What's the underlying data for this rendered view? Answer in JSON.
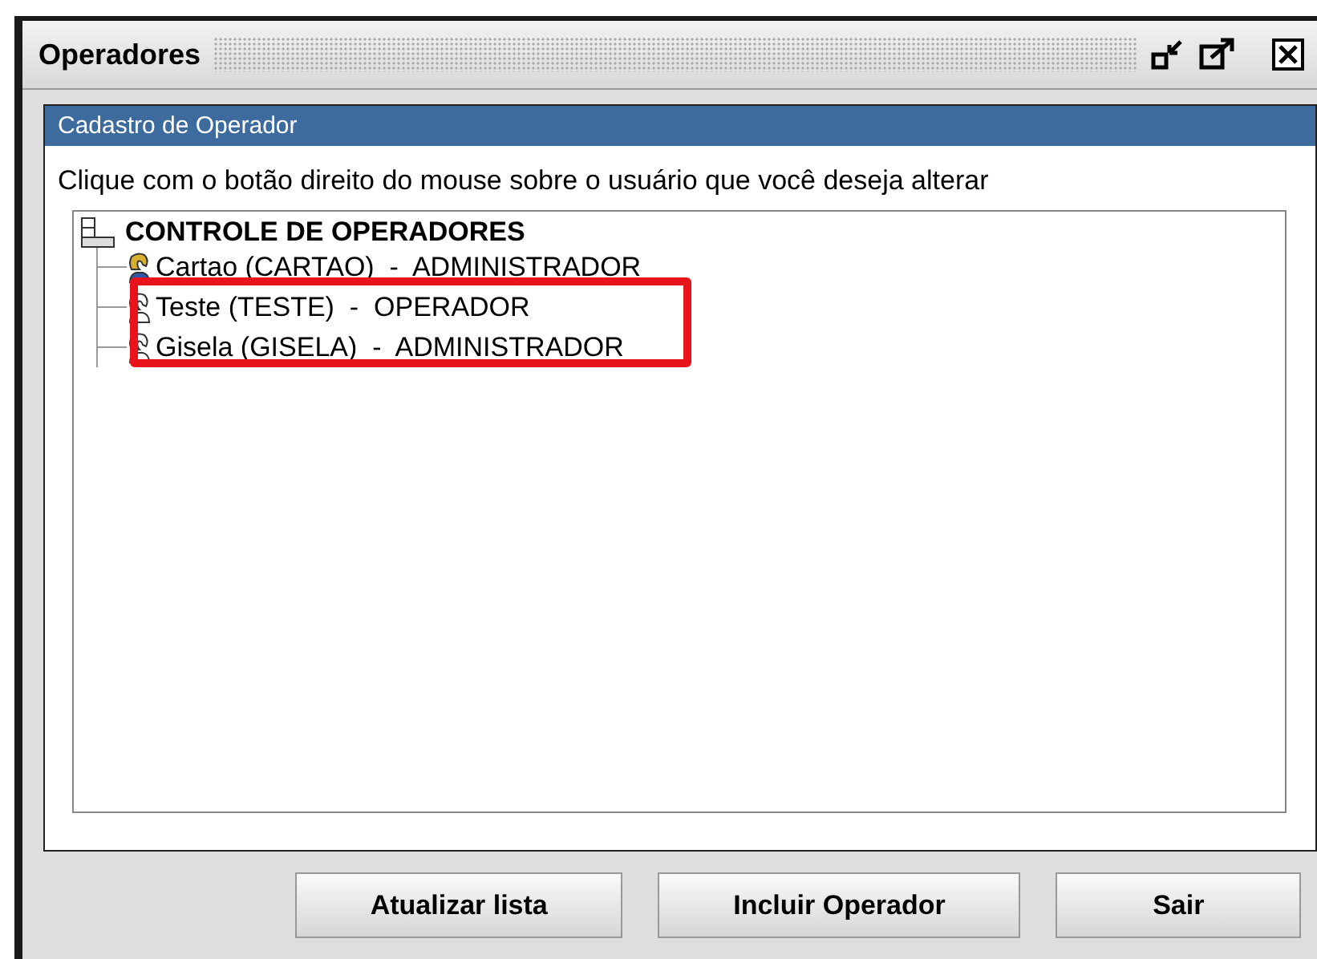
{
  "window": {
    "title": "Operadores"
  },
  "panel": {
    "title": "Cadastro de Operador",
    "instruction": "Clique com o botão direito do mouse sobre o usuário que você deseja alterar"
  },
  "tree": {
    "root": "CONTROLE DE OPERADORES",
    "expanded": true,
    "children": [
      {
        "label": "Cartao (CARTAO)  -  ADMINISTRADOR",
        "active": true,
        "highlighted": false
      },
      {
        "label": "Teste (TESTE)  -  OPERADOR",
        "active": false,
        "highlighted": true
      },
      {
        "label": "Gisela (GISELA)  -  ADMINISTRADOR",
        "active": false,
        "highlighted": true
      }
    ]
  },
  "buttons": [
    "Atualizar lista",
    "Incluir Operador",
    "Sair"
  ]
}
